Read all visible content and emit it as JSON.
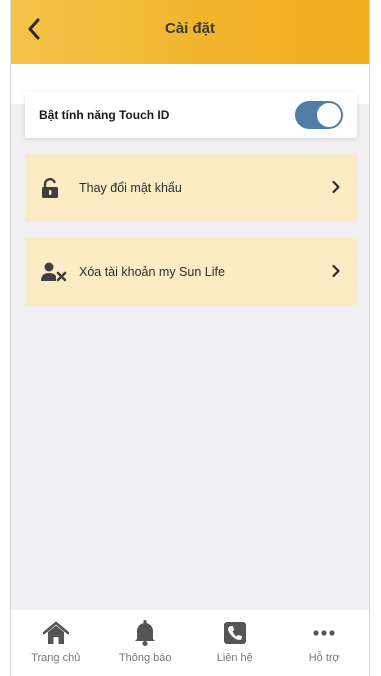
{
  "header": {
    "title": "Cài đặt",
    "back_icon": "chevron-left-icon"
  },
  "settings": {
    "touch_id": {
      "label": "Bật tính năng Touch ID",
      "enabled": true
    },
    "menu": [
      {
        "label": "Thay đổi mật khẩu",
        "icon": "unlock-icon"
      },
      {
        "label": "Xóa tài khoản my Sun Life",
        "icon": "user-remove-icon"
      }
    ]
  },
  "tabbar": {
    "items": [
      {
        "label": "Trang chủ",
        "icon": "home-icon"
      },
      {
        "label": "Thông báo",
        "icon": "bell-icon"
      },
      {
        "label": "Liên hệ",
        "icon": "phone-icon"
      },
      {
        "label": "Hỗ trợ",
        "icon": "more-icon"
      }
    ]
  },
  "colors": {
    "header_start": "#f4c24a",
    "header_end": "#efad20",
    "menu_row_bg": "#fbecc6",
    "toggle_on": "#4e7ea8",
    "icon_dark": "#3f3f3f"
  }
}
